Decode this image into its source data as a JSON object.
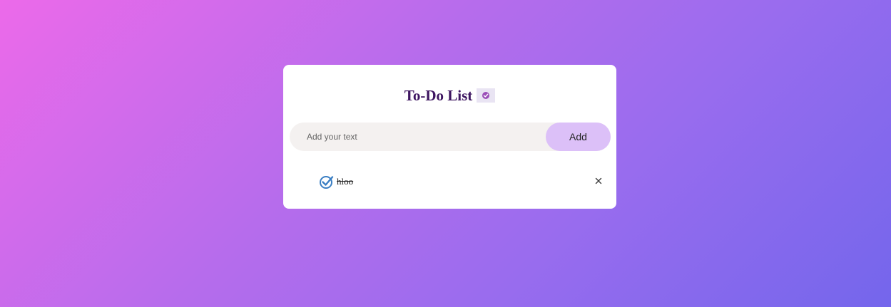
{
  "app": {
    "title": "To-Do List",
    "title_icon": "check-badge-icon"
  },
  "input": {
    "placeholder": "Add your text",
    "value": ""
  },
  "add_button": {
    "label": "Add"
  },
  "tasks": [
    {
      "text": "hloo",
      "completed": true,
      "check_icon": "checked-circle-icon",
      "remove_icon": "close-icon"
    }
  ],
  "colors": {
    "background_gradient": [
      "#ec6aea",
      "#7466ec"
    ],
    "title": "#3d1560",
    "add_button": "#dcc0f8",
    "input_background": "#f4f1f0",
    "check": "#3b7fc4"
  }
}
